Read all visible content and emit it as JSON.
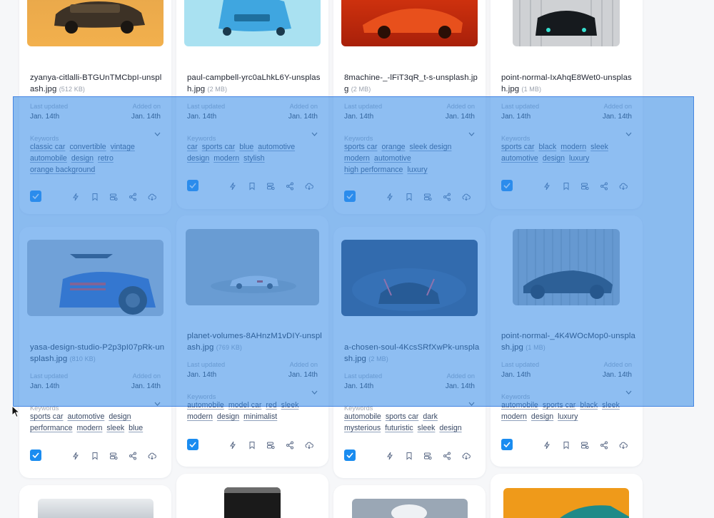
{
  "labels": {
    "last_updated": "Last updated",
    "added_on": "Added on",
    "keywords": "Keywords"
  },
  "cards": [
    {
      "name": "zyanya-citlalli-BTGUnTMCbpI-unsplash.jpg",
      "size": "(512 KB)",
      "updated": "Jan. 14th",
      "added": "Jan. 14th",
      "keywords": [
        "classic car",
        "convertible",
        "vintage",
        "automobile",
        "design",
        "retro",
        "orange background"
      ],
      "thumb_icon": "vintage-car-orange-photo"
    },
    {
      "name": "paul-campbell-yrc0aLhkL6Y-unsplash.jpg",
      "size": "(2 MB)",
      "updated": "Jan. 14th",
      "added": "Jan. 14th",
      "keywords": [
        "car",
        "sports car",
        "blue",
        "automotive",
        "design",
        "modern",
        "stylish"
      ],
      "thumb_icon": "blue-sports-car-photo"
    },
    {
      "name": "8machine-_-lFiT3qR_t-s-unsplash.jpg",
      "size": "(2 MB)",
      "updated": "Jan. 14th",
      "added": "Jan. 14th",
      "keywords": [
        "sports car",
        "orange",
        "sleek design",
        "modern",
        "automotive",
        "high performance",
        "luxury"
      ],
      "thumb_icon": "orange-supercar-photo"
    },
    {
      "name": "point-normal-IxAhqE8Wet0-unsplash.jpg",
      "size": "(1 MB)",
      "updated": "Jan. 14th",
      "added": "Jan. 14th",
      "keywords": [
        "sports car",
        "black",
        "modern",
        "sleek",
        "automotive",
        "design",
        "luxury"
      ],
      "thumb_icon": "black-car-front-photo"
    },
    {
      "name": "yasa-design-studio-P2p3pI07pRk-unsplash.jpg",
      "size": "(810 KB)",
      "updated": "Jan. 14th",
      "added": "Jan. 14th",
      "keywords": [
        "sports car",
        "automotive",
        "design",
        "performance",
        "modern",
        "sleek",
        "blue"
      ],
      "thumb_icon": "blue-car-rear-photo"
    },
    {
      "name": "planet-volumes-8AHnzM1vDIY-unsplash.jpg",
      "size": "(769 KB)",
      "updated": "Jan. 14th",
      "added": "Jan. 14th",
      "keywords": [
        "automobile",
        "model car",
        "red",
        "sleek",
        "modern",
        "design",
        "minimalist"
      ],
      "thumb_icon": "model-car-grey-photo"
    },
    {
      "name": "a-chosen-soul-4KcsSRfXwPk-unsplash.jpg",
      "size": "(2 MB)",
      "updated": "Jan. 14th",
      "added": "Jan. 14th",
      "keywords": [
        "automobile",
        "sports car",
        "dark",
        "mysterious",
        "futuristic",
        "sleek",
        "design"
      ],
      "thumb_icon": "dark-car-fog-photo"
    },
    {
      "name": "point-normal-_4K4WOcMop0-unsplash.jpg",
      "size": "(1 MB)",
      "updated": "Jan. 14th",
      "added": "Jan. 14th",
      "keywords": [
        "automobile",
        "sports car",
        "black",
        "sleek",
        "modern",
        "design",
        "luxury"
      ],
      "thumb_icon": "black-car-side-photo"
    }
  ],
  "actions": [
    "bolt-icon",
    "bookmark-icon",
    "tag-list-icon",
    "share-icon",
    "cloud-download-icon"
  ],
  "colors": {
    "accent": "#1a8cf0",
    "selection": "#3a8ce8"
  }
}
